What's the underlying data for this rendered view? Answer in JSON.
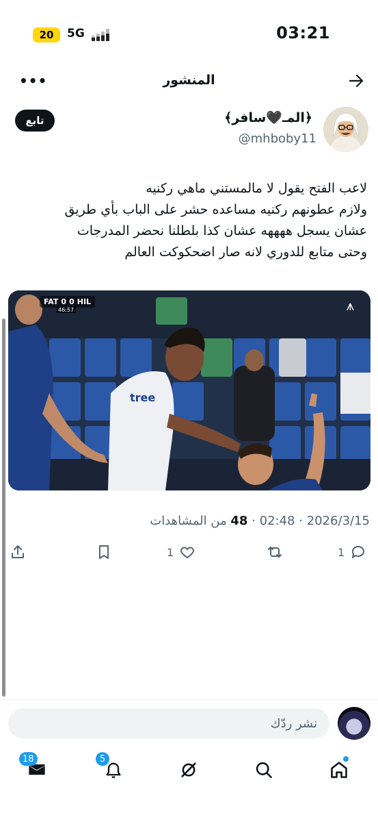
{
  "status_bar": {
    "battery": "20",
    "network": "5G",
    "time": "03:21"
  },
  "header": {
    "title": "المنشور",
    "more_icon": "more-horizontal-icon",
    "back_icon": "arrow-right-icon"
  },
  "author": {
    "display_name": "﴿المـ🖤سافر﴾",
    "handle": "@mhboby11",
    "follow_label": "تابع"
  },
  "post": {
    "lines": [
      "لاعب الفتح يقول لا مالمستني ماهي ركنيه",
      "ولازم عطونهم ركنيه مساعده حشر على الباب بأي طريق",
      "عشان يسجل ههههه عشان كذا بلطلنا نحضر المدرجات",
      "وحتى متابع للدوري لانه صار اضحكوكت العالم"
    ]
  },
  "media": {
    "scoreboard": {
      "home": "FAT",
      "home_score": "0",
      "away_score": "0",
      "away": "HIL",
      "clock": "46:57"
    },
    "description_icon": "video-icon"
  },
  "meta": {
    "date": "2026/3/15",
    "time": "02:48",
    "views": "48",
    "views_label": "من المشاهدات"
  },
  "actions": {
    "reply_count": "1",
    "retweet_count": "",
    "like_count": "1",
    "colors": {
      "icon": "#536471"
    }
  },
  "reply_bar": {
    "placeholder": "نشر ردّك"
  },
  "bottom_nav": {
    "messages_badge": "18",
    "notifications_badge": "5"
  },
  "colors": {
    "accent": "#1d9bf0",
    "text": "#0f1419",
    "muted": "#536471"
  }
}
